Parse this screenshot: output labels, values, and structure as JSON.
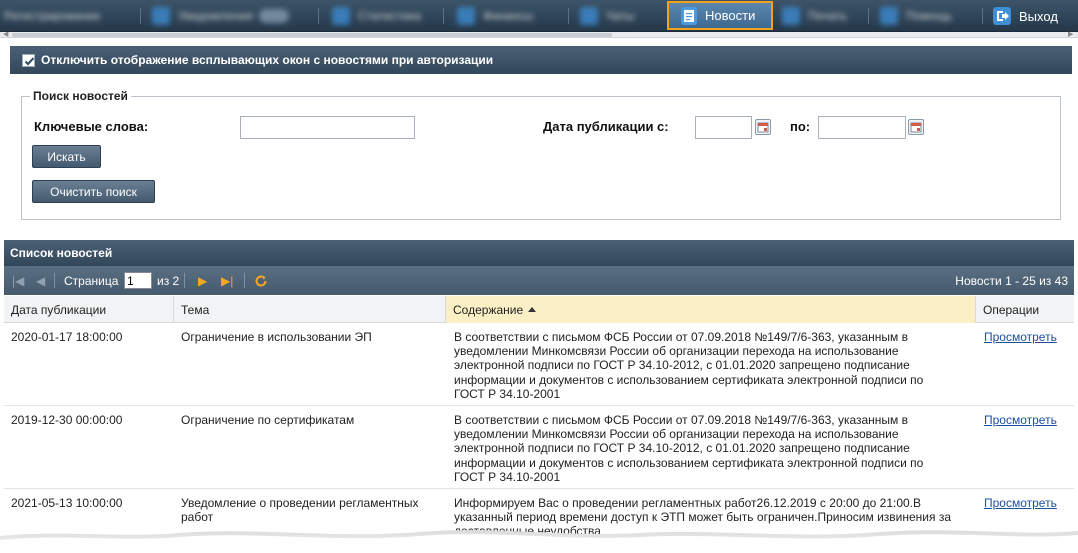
{
  "topnav": {
    "items_blurred": [
      {
        "label": "Регистрирование",
        "icon": "register-icon"
      },
      {
        "label": "Уведомления",
        "icon": "bell-icon"
      },
      {
        "label": "Статистика",
        "icon": "chart-icon"
      },
      {
        "label": "Финансы",
        "icon": "money-icon"
      },
      {
        "label": "Чаты",
        "icon": "chat-icon"
      }
    ],
    "active": {
      "label": "Новости",
      "icon": "news-icon"
    },
    "more_blurred": [
      {
        "label": "Печать",
        "icon": "print-icon"
      },
      {
        "label": "Помощь",
        "icon": "help-icon"
      }
    ],
    "exit": {
      "label": "Выход",
      "icon": "exit-icon"
    }
  },
  "notice": {
    "checked": true,
    "label": "Отключить отображение всплывающих окон с новостями при авторизации"
  },
  "search": {
    "legend": "Поиск новостей",
    "keywords_label": "Ключевые слова:",
    "keywords_value": "",
    "date_label": "Дата публикации с:",
    "date_from_value": "",
    "date_to_label": "по:",
    "date_to_value": "",
    "search_button": "Искать",
    "clear_button": "Очистить поиск"
  },
  "news_list": {
    "title": "Список новостей",
    "pager": {
      "page_label": "Страница",
      "page_value": "1",
      "of_label": "из 2",
      "range_text": "Новости 1 - 25 из 43"
    },
    "columns": [
      "Дата публикации",
      "Тема",
      "Содержание",
      "Операции"
    ],
    "sorted_column": "Содержание",
    "rows": [
      {
        "date": "2020-01-17 18:00:00",
        "subject": "Ограничение в использовании ЭП",
        "content_lines": [
          "В соответствии с письмом ФСБ России от 07.09.2018 №149/7/6-363, указанным в",
          "уведомлении Минкомсвязи России об организации перехода на использование",
          "электронной подписи по ГОСТ Р 34.10-2012, с 01.01.2020 запрещено подписание",
          "информации и документов с использованием сертификата электронной подписи по",
          "ГОСТ Р 34.10-2001"
        ],
        "action": "Просмотреть"
      },
      {
        "date": "2019-12-30 00:00:00",
        "subject": "Ограничение по сертификатам",
        "content_lines": [
          "В соответствии с письмом ФСБ России от 07.09.2018 №149/7/6-363, указанным в",
          "уведомлении Минкомсвязи России об организации перехода на использование",
          "электронной подписи по ГОСТ Р 34.10-2012, с 01.01.2020 запрещено подписание",
          "информации и документов с использованием сертификата электронной подписи по",
          "ГОСТ Р 34.10-2001"
        ],
        "action": "Просмотреть"
      },
      {
        "date": "2021-05-13 10:00:00",
        "subject_lines": [
          "Уведомление о проведении регламентных",
          "работ"
        ],
        "content_lines": [
          "Информируем Вас о проведении регламентных работ26.12.2019 с 20:00 до 21:00.В",
          "указанный период времени доступ к ЭТП может быть ограничен.Приносим извинения за",
          "доставленные неудобства"
        ],
        "action": "Просмотреть"
      }
    ]
  }
}
